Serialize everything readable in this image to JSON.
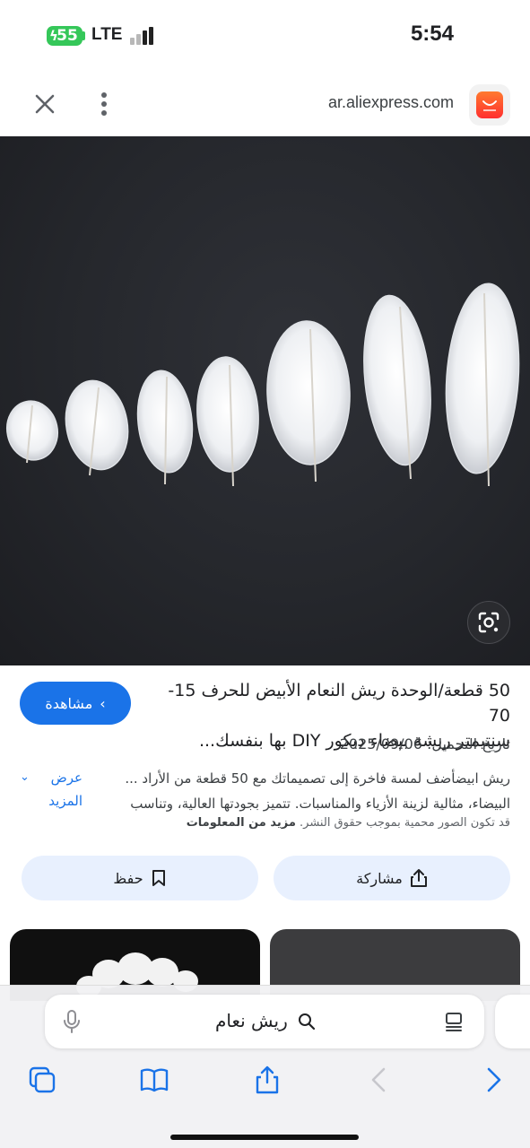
{
  "status_bar": {
    "battery_level": "55",
    "network": "LTE",
    "time": "5:54"
  },
  "browser": {
    "url": "ar.aliexpress.com",
    "site_icon": "aliexpress-logo-icon"
  },
  "result": {
    "visit_label": "مشاهدة",
    "title_line1": "50 قطعة/الوحدة ريش النعام الأبيض للحرف 15-70",
    "title_line2": "سنتيمتر ريشة بيضاء ديكور DIY بها بنفسك...",
    "upload_date": "تاريخ التحميل: 2025/09/06",
    "description_line1": "ريش ابيضأضف لمسة فاخرة إلى تصميماتك مع 50 قطعة من الأراد ...",
    "description_line2": "البيضاء، مثالية لزينة الأزياء والمناسبات. تتميز بجودتها العالية، وتناسب",
    "more_label": "عرض المزيد",
    "copyright_notice": "قد تكون الصور محمية بموجب حقوق النشر.",
    "more_info_label": "مزيد من المعلومات",
    "share_label": "مشاركة",
    "save_label": "حفظ"
  },
  "search": {
    "query": "ريش نعام"
  },
  "colors": {
    "accent": "#1a73e8",
    "action_bg": "#e8f0fe",
    "battery": "#35c759"
  }
}
